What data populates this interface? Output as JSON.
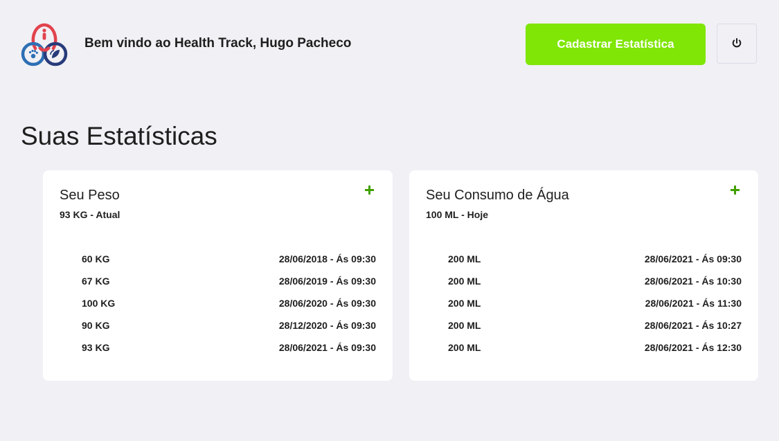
{
  "header": {
    "welcome": "Bem vindo ao Health Track, Hugo Pacheco",
    "register_button": "Cadastrar Estatística",
    "logo_icon": "health-track-logo-icon",
    "power_icon": "power-icon"
  },
  "colors": {
    "background": "#f0f0f5",
    "accent": "#7fe606",
    "add_icon": "#41a000",
    "card": "#ffffff"
  },
  "main": {
    "title": "Suas Estatísticas",
    "cards": [
      {
        "title": "Seu Peso",
        "subtitle": "93 KG - Atual",
        "add_icon": "plus-icon",
        "entries": [
          {
            "value": "60 KG",
            "date": "28/06/2018 - Ás 09:30"
          },
          {
            "value": "67 KG",
            "date": "28/06/2019 - Ás 09:30"
          },
          {
            "value": "100 KG",
            "date": "28/06/2020 - Ás 09:30"
          },
          {
            "value": "90 KG",
            "date": "28/12/2020 - Ás 09:30"
          },
          {
            "value": "93 KG",
            "date": "28/06/2021 - Ás 09:30"
          }
        ]
      },
      {
        "title": "Seu Consumo de Água",
        "subtitle": "100 ML - Hoje",
        "add_icon": "plus-icon",
        "entries": [
          {
            "value": "200 ML",
            "date": "28/06/2021 - Ás 09:30"
          },
          {
            "value": "200 ML",
            "date": "28/06/2021 - Ás 10:30"
          },
          {
            "value": "200 ML",
            "date": "28/06/2021 - Ás 11:30"
          },
          {
            "value": "200 ML",
            "date": "28/06/2021 - Ás 10:27"
          },
          {
            "value": "200 ML",
            "date": "28/06/2021 - Ás 12:30"
          }
        ]
      }
    ]
  }
}
